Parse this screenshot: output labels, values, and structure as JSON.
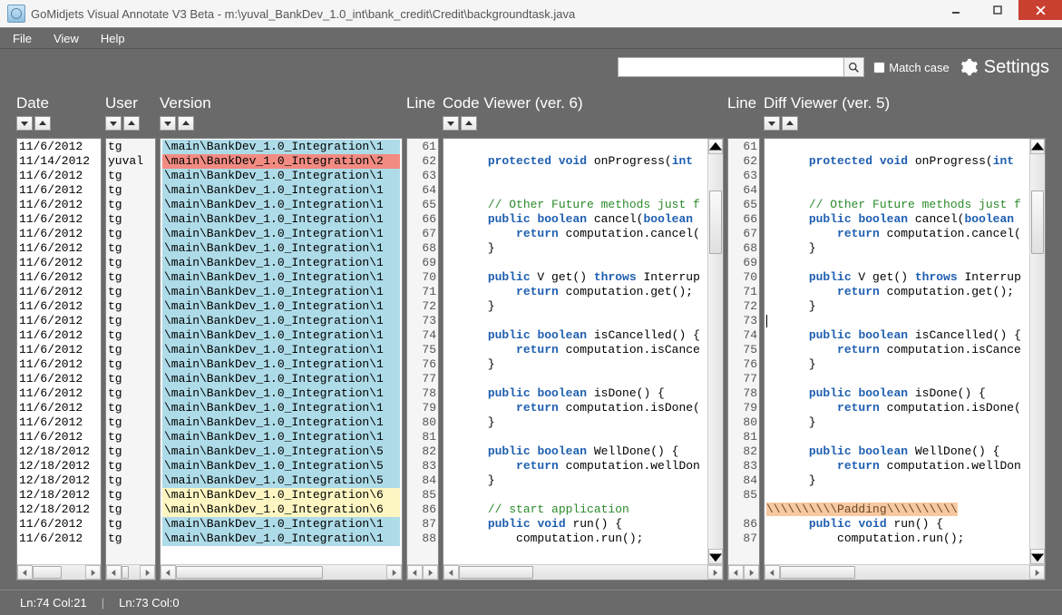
{
  "window": {
    "title": "GoMidjets Visual Annotate V3 Beta - m:\\yuval_BankDev_1.0_int\\bank_credit\\Credit\\backgroundtask.java"
  },
  "menu": {
    "file": "File",
    "view": "View",
    "help": "Help"
  },
  "toolbar": {
    "search_placeholder": "",
    "match_case_label": "Match case",
    "settings_label": "Settings"
  },
  "columns": {
    "date": "Date",
    "user": "User",
    "version": "Version",
    "line": "Line",
    "code": "Code Viewer (ver. 6)",
    "diff": "Diff Viewer (ver. 5)"
  },
  "rows": [
    {
      "date": "11/6/2012",
      "user": "tg",
      "ver": "\\main\\BankDev_1.0_Integration\\1",
      "color": "blue"
    },
    {
      "date": "11/14/2012",
      "user": "yuval",
      "ver": "\\main\\BankDev_1.0_Integration\\2",
      "color": "red"
    },
    {
      "date": "11/6/2012",
      "user": "tg",
      "ver": "\\main\\BankDev_1.0_Integration\\1",
      "color": "blue"
    },
    {
      "date": "11/6/2012",
      "user": "tg",
      "ver": "\\main\\BankDev_1.0_Integration\\1",
      "color": "blue"
    },
    {
      "date": "11/6/2012",
      "user": "tg",
      "ver": "\\main\\BankDev_1.0_Integration\\1",
      "color": "blue"
    },
    {
      "date": "11/6/2012",
      "user": "tg",
      "ver": "\\main\\BankDev_1.0_Integration\\1",
      "color": "blue"
    },
    {
      "date": "11/6/2012",
      "user": "tg",
      "ver": "\\main\\BankDev_1.0_Integration\\1",
      "color": "blue"
    },
    {
      "date": "11/6/2012",
      "user": "tg",
      "ver": "\\main\\BankDev_1.0_Integration\\1",
      "color": "blue"
    },
    {
      "date": "11/6/2012",
      "user": "tg",
      "ver": "\\main\\BankDev_1.0_Integration\\1",
      "color": "blue"
    },
    {
      "date": "11/6/2012",
      "user": "tg",
      "ver": "\\main\\BankDev_1.0_Integration\\1",
      "color": "blue"
    },
    {
      "date": "11/6/2012",
      "user": "tg",
      "ver": "\\main\\BankDev_1.0_Integration\\1",
      "color": "blue"
    },
    {
      "date": "11/6/2012",
      "user": "tg",
      "ver": "\\main\\BankDev_1.0_Integration\\1",
      "color": "blue"
    },
    {
      "date": "11/6/2012",
      "user": "tg",
      "ver": "\\main\\BankDev_1.0_Integration\\1",
      "color": "blue"
    },
    {
      "date": "11/6/2012",
      "user": "tg",
      "ver": "\\main\\BankDev_1.0_Integration\\1",
      "color": "blue"
    },
    {
      "date": "11/6/2012",
      "user": "tg",
      "ver": "\\main\\BankDev_1.0_Integration\\1",
      "color": "blue"
    },
    {
      "date": "11/6/2012",
      "user": "tg",
      "ver": "\\main\\BankDev_1.0_Integration\\1",
      "color": "blue"
    },
    {
      "date": "11/6/2012",
      "user": "tg",
      "ver": "\\main\\BankDev_1.0_Integration\\1",
      "color": "blue"
    },
    {
      "date": "11/6/2012",
      "user": "tg",
      "ver": "\\main\\BankDev_1.0_Integration\\1",
      "color": "blue"
    },
    {
      "date": "11/6/2012",
      "user": "tg",
      "ver": "\\main\\BankDev_1.0_Integration\\1",
      "color": "blue"
    },
    {
      "date": "11/6/2012",
      "user": "tg",
      "ver": "\\main\\BankDev_1.0_Integration\\1",
      "color": "blue"
    },
    {
      "date": "11/6/2012",
      "user": "tg",
      "ver": "\\main\\BankDev_1.0_Integration\\1",
      "color": "blue"
    },
    {
      "date": "12/18/2012",
      "user": "tg",
      "ver": "\\main\\BankDev_1.0_Integration\\5",
      "color": "blue"
    },
    {
      "date": "12/18/2012",
      "user": "tg",
      "ver": "\\main\\BankDev_1.0_Integration\\5",
      "color": "blue"
    },
    {
      "date": "12/18/2012",
      "user": "tg",
      "ver": "\\main\\BankDev_1.0_Integration\\5",
      "color": "blue"
    },
    {
      "date": "12/18/2012",
      "user": "tg",
      "ver": "\\main\\BankDev_1.0_Integration\\6",
      "color": "yellow"
    },
    {
      "date": "12/18/2012",
      "user": "tg",
      "ver": "\\main\\BankDev_1.0_Integration\\6",
      "color": "yellow"
    },
    {
      "date": "11/6/2012",
      "user": "tg",
      "ver": "\\main\\BankDev_1.0_Integration\\1",
      "color": "blue"
    },
    {
      "date": "11/6/2012",
      "user": "tg",
      "ver": "\\main\\BankDev_1.0_Integration\\1",
      "color": "blue"
    }
  ],
  "code_lines_start": 61,
  "code_lines_count": 28,
  "code_html": [
    "",
    "      <span class='kw'>protected</span> <span class='kw'>void</span> onProgress(<span class='kw'>int</span>",
    "",
    "",
    "      <span class='cm'>// Other Future methods just f</span>",
    "      <span class='kw'>public</span> <span class='kw'>boolean</span> cancel(<span class='kw'>boolean</span>",
    "          <span class='kw'>return</span> computation.cancel(",
    "      }",
    "",
    "      <span class='kw'>public</span> V get() <span class='kw'>throws</span> Interrup",
    "          <span class='kw'>return</span> computation.get();",
    "      }",
    "",
    "      <span class='kw'>public</span> <span class='kw'>boolean</span> isCancelled() {",
    "          <span class='kw'>return</span> computation.isCance",
    "      }",
    "",
    "      <span class='kw'>public</span> <span class='kw'>boolean</span> isDone() {",
    "          <span class='kw'>return</span> computation.isDone(",
    "      }",
    "",
    "      <span class='kw'>public</span> <span class='kw'>boolean</span> WellDone() {",
    "          <span class='kw'>return</span> computation.wellDon",
    "      }",
    "",
    "      <span class='cm'>// start application</span>",
    "      <span class='kw'>public</span> <span class='kw'>void</span> run() {",
    "          computation.run();"
  ],
  "diff_line_numbers": [
    "61",
    "62",
    "63",
    "64",
    "65",
    "66",
    "67",
    "68",
    "69",
    "70",
    "71",
    "72",
    "73",
    "74",
    "75",
    "76",
    "77",
    "78",
    "79",
    "80",
    "81",
    "82",
    "83",
    "84",
    "85",
    "",
    "86",
    "87"
  ],
  "diff_html": [
    "",
    "      <span class='kw'>protected</span> <span class='kw'>void</span> onProgress(<span class='kw'>int</span>",
    "",
    "",
    "      <span class='cm'>// Other Future methods just f</span>",
    "      <span class='kw'>public</span> <span class='kw'>boolean</span> cancel(<span class='kw'>boolean</span>",
    "          <span class='kw'>return</span> computation.cancel(",
    "      }",
    "",
    "      <span class='kw'>public</span> V get() <span class='kw'>throws</span> Interrup",
    "          <span class='kw'>return</span> computation.get();",
    "      }",
    "<span class='cursor'></span>",
    "      <span class='kw'>public</span> <span class='kw'>boolean</span> isCancelled() {",
    "          <span class='kw'>return</span> computation.isCance",
    "      }",
    "",
    "      <span class='kw'>public</span> <span class='kw'>boolean</span> isDone() {",
    "          <span class='kw'>return</span> computation.isDone(",
    "      }",
    "",
    "      <span class='kw'>public</span> <span class='kw'>boolean</span> WellDone() {",
    "          <span class='kw'>return</span> computation.wellDon",
    "      }",
    "",
    "<span class='pad'>\\\\\\\\\\\\\\\\\\\\Padding\\\\\\\\\\\\\\\\\\\\</span>",
    "      <span class='kw'>public</span> <span class='kw'>void</span> run() {",
    "          computation.run();"
  ],
  "status": {
    "left": "Ln:74 Col:21",
    "right": "Ln:73 Col:0"
  }
}
